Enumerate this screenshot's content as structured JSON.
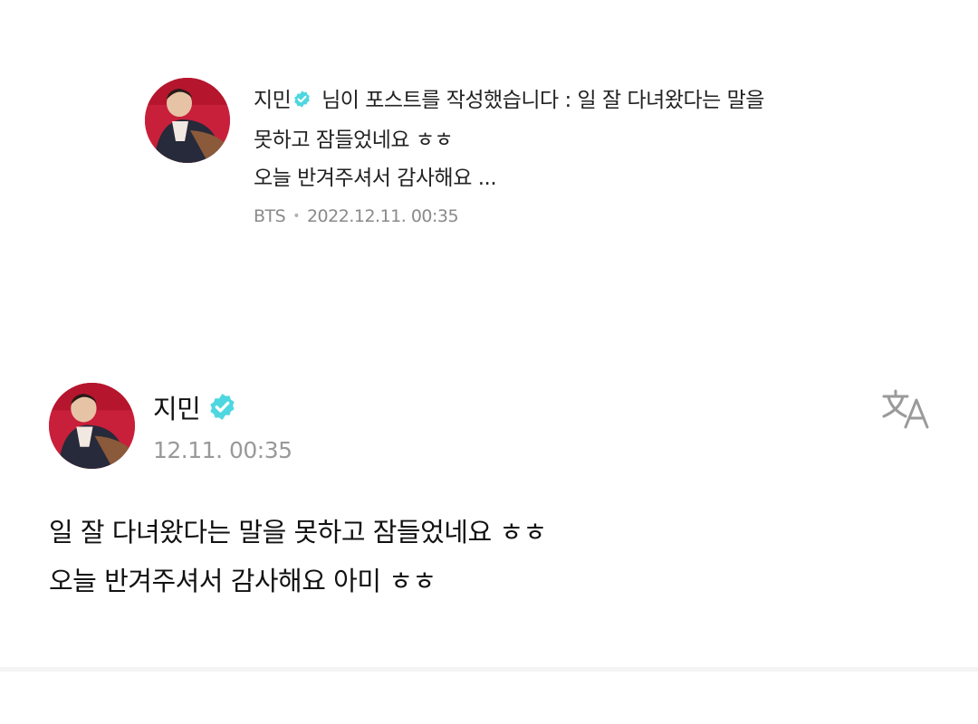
{
  "notification": {
    "author": "지민",
    "message_line1": "님이 포스트를 작성했습니다 : 일 잘 다녀왔다는 말을",
    "message_line2": "못하고 잠들었네요 ㅎㅎ",
    "message_line3": "오늘 반겨주셔서 감사해요 ...",
    "community": "BTS",
    "timestamp": "2022.12.11. 00:35"
  },
  "post": {
    "author": "지민",
    "timestamp": "12.11. 00:35",
    "body_line1": "일 잘 다녀왔다는 말을 못하고 잠들었네요 ㅎㅎ",
    "body_line2": "오늘 반겨주셔서 감사해요 아미 ㅎㅎ"
  },
  "icons": {
    "verified": "verified-badge-icon",
    "translate": "translate-icon"
  },
  "colors": {
    "verified_badge": "#4ed7e0",
    "avatar_bg": "#c8203a"
  }
}
